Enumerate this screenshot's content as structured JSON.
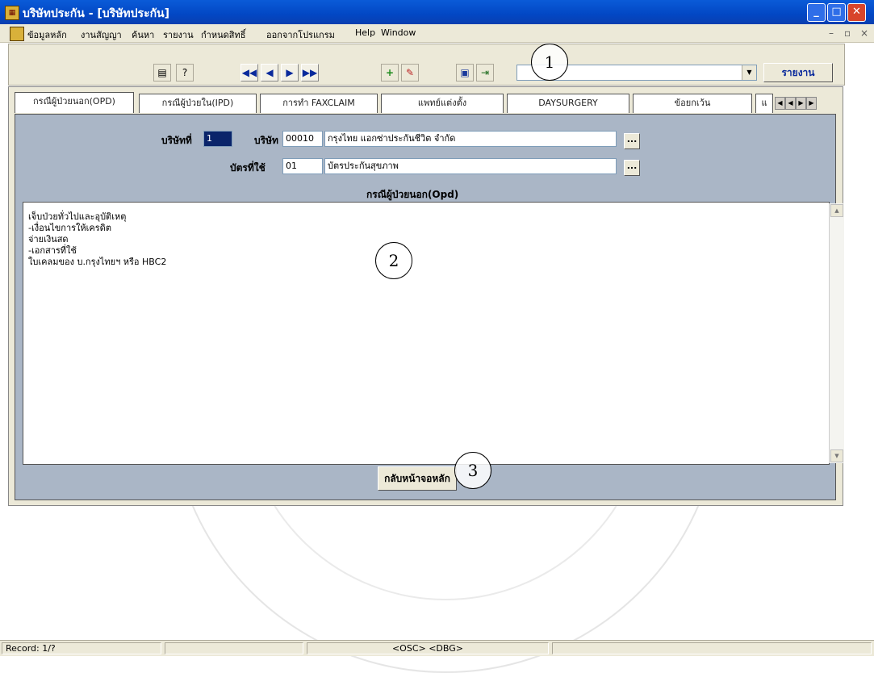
{
  "window": {
    "title": "บริษัทประกัน - [บริษัทประกัน]",
    "controls": [
      "_",
      "□",
      "✕"
    ]
  },
  "menu": {
    "items": [
      "ข้อมูลหลัก",
      "งานสัญญา",
      "ค้นหา",
      "รายงาน",
      "กำหนดสิทธิ์",
      "ออกจากโปรแกรม",
      "Help",
      "Window"
    ],
    "mdi_controls": [
      "–",
      "▫",
      "×"
    ]
  },
  "toolbar": {
    "combo_value": "",
    "report_button": "รายงาน",
    "nav_first": "◀◀",
    "nav_prev": "◀",
    "nav_next": "▶",
    "nav_last": "▶▶"
  },
  "callouts": [
    "1",
    "2",
    "3"
  ],
  "tabs": [
    {
      "label": "กรณีผู้ป่วยนอก(OPD)",
      "active": true
    },
    {
      "label": "กรณีผู้ป่วยใน(IPD)",
      "active": false
    },
    {
      "label": "การทำ FAXCLAIM",
      "active": false
    },
    {
      "label": "แพทย์แต่งตั้ง",
      "active": false
    },
    {
      "label": "DAYSURGERY",
      "active": false
    },
    {
      "label": "ข้อยกเว้น",
      "active": false
    },
    {
      "label": "แ",
      "active": false
    }
  ],
  "form": {
    "company_no_label": "บริษัทที่",
    "company_no_value": "1",
    "company_label": "บริษัท",
    "company_code": "00010",
    "company_name": "กรุงไทย แอกซ่าประกันชีวิต จำกัด",
    "card_label": "บัตรที่ใช้",
    "card_code": "01",
    "card_name": "บัตรประกันสุขภาพ",
    "dots": "...",
    "section_title": "กรณีผู้ป่วยนอก(Opd)",
    "memo_lines": [
      "เจ็บป่วยทั่วไปและอุบัติเหตุ",
      "-เงื่อนไขการให้เครดิต",
      "จ่ายเงินสด",
      "-เอกสารที่ใช้",
      "ใบเคลมของ บ.กรุงไทยฯ หรือ HBC2"
    ],
    "back_button": "กลับหน้าจอหลัก"
  },
  "status": {
    "record": "Record: 1/?",
    "panel_text": "<OSC> <DBG>"
  }
}
